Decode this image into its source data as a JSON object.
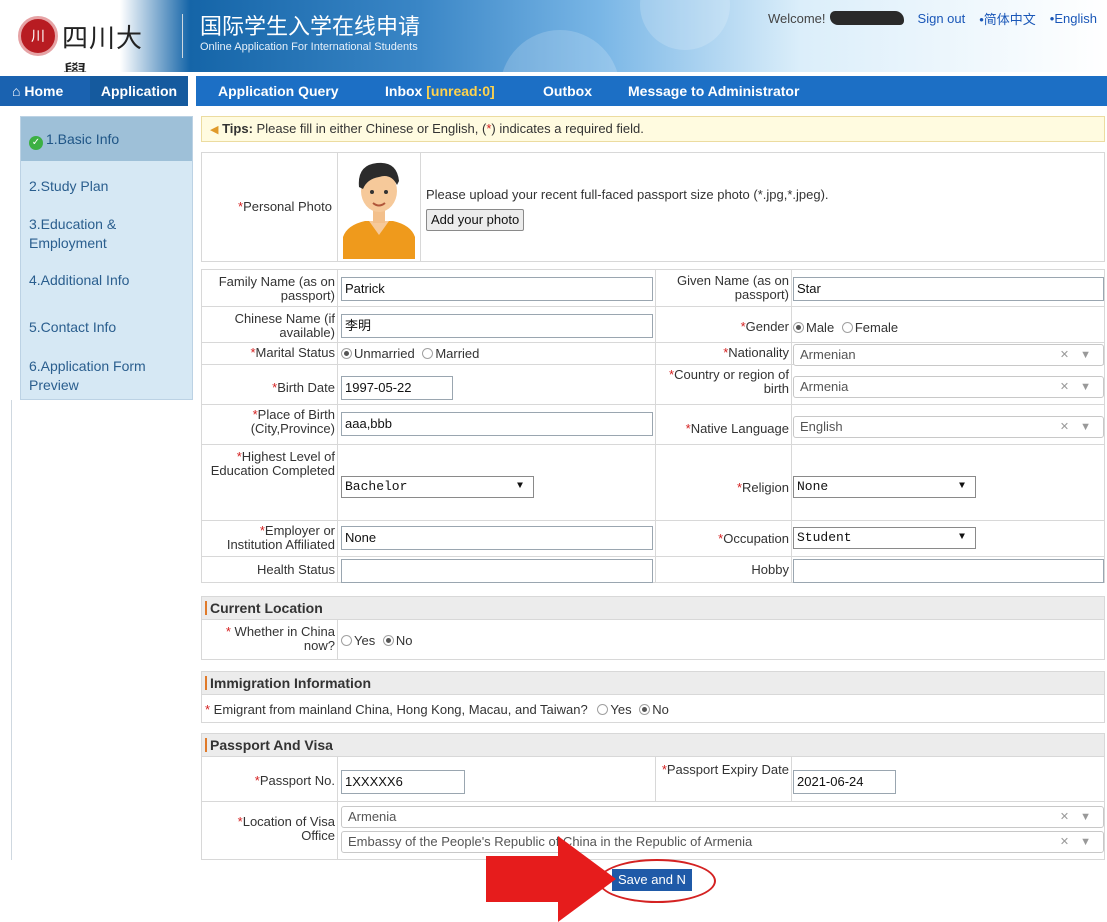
{
  "header": {
    "logo_text": "四川大學",
    "seal_text": "川",
    "title_cn": "国际学生入学在线申请",
    "title_en": "Online Application For International Students",
    "welcome": "Welcome!",
    "sign_out": "Sign out",
    "lang_cn": "•简体中文",
    "lang_en": "•English"
  },
  "nav": {
    "home": "Home",
    "application": "Application",
    "query": "Application Query",
    "inbox": "Inbox",
    "inbox_unread": "[unread:0]",
    "outbox": "Outbox",
    "message": "Message to Administrator"
  },
  "sidebar": {
    "steps": [
      "1.Basic Info",
      "2.Study Plan",
      "3.Education & Employment",
      "4.Additional Info",
      "5.Contact Info",
      "6.Application Form Preview"
    ]
  },
  "tips": {
    "label": "Tips:",
    "text_a": "Please fill in either Chinese or English, (",
    "text_req": "*",
    "text_b": ") indicates a required field."
  },
  "photo": {
    "label": "Personal Photo",
    "desc": "Please upload your recent full-faced passport size photo (*.jpg,*.jpeg).",
    "button": "Add your photo"
  },
  "form": {
    "family_name_label": "Family Name (as on passport)",
    "family_name": "Patrick",
    "given_name_label": "Given Name (as on passport)",
    "given_name": "Star",
    "chinese_name_label": "Chinese Name (if available)",
    "chinese_name": "李明",
    "gender_label": "Gender",
    "gender_male": "Male",
    "gender_female": "Female",
    "marital_label": "Marital Status",
    "marital_unmarried": "Unmarried",
    "marital_married": "Married",
    "nationality_label": "Nationality",
    "nationality": "Armenian",
    "birth_date_label": "Birth Date",
    "birth_date": "1997-05-22",
    "birth_country_label": "Country or region of birth",
    "birth_country": "Armenia",
    "birth_place_label": "Place of Birth (City,Province)",
    "birth_place": "aaa,bbb",
    "native_lang_label": "Native Language",
    "native_lang": "English",
    "education_label": "Highest Level of Education Completed",
    "education": "Bachelor",
    "religion_label": "Religion",
    "religion": "None",
    "employer_label": "Employer or Institution Affiliated",
    "employer": "None",
    "occupation_label": "Occupation",
    "occupation": "Student",
    "health_label": "Health Status",
    "health": "",
    "hobby_label": "Hobby",
    "hobby": ""
  },
  "location": {
    "title": "Current Location",
    "in_china_label": "Whether in China now?",
    "yes": "Yes",
    "no": "No"
  },
  "immigration": {
    "title": "Immigration Information",
    "question": "Emigrant from mainland China, Hong Kong, Macau, and Taiwan?",
    "yes": "Yes",
    "no": "No"
  },
  "passport": {
    "title": "Passport And Visa",
    "number_label": "Passport No.",
    "number": "1XXXXX6",
    "expiry_label": "Passport Expiry Date",
    "expiry": "2021-06-24",
    "visa_label": "Location of Visa Office",
    "visa_country": "Armenia",
    "visa_office": "Embassy of the People's Republic of China in the Republic of Armenia"
  },
  "actions": {
    "save": "Save and N"
  },
  "colors": {
    "nav_blue": "#1c6fc5",
    "required_red": "#d42020",
    "annotation_red": "#e61c1c"
  }
}
